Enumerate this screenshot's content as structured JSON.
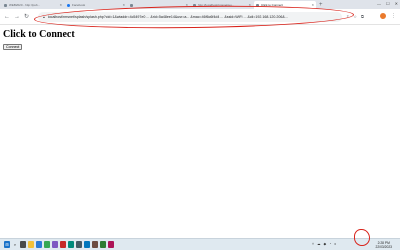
{
  "tabs": [
    {
      "label": "WEB2020 - http://pub...",
      "active": false
    },
    {
      "label": "Facebook",
      "active": false
    },
    {
      "label": "",
      "active": false
    },
    {
      "label": "http://localhost/rmsnet/au...",
      "active": false
    },
    {
      "label": "Click to Connect",
      "active": true
    }
  ],
  "toolbar": {
    "address": "localhost/rmsnet/splash/splash.php?cid=1&wiaddr=4c5497e0 ... &rid=5a48ee14&usr=a... &mac=46f6c6f4d4 ... &ssid=WiFi ... &cli=192.168.120.206&..."
  },
  "page": {
    "heading": "Click to Connect",
    "connect_button": "Connect"
  },
  "taskbar": {
    "time": "2:28 PM",
    "date": "22/03/2023"
  },
  "colors": {
    "annotation": "#d9241c",
    "tab_strip": "#dfe3ea",
    "taskbar": "#dfe9f0"
  },
  "icons": [
    "back-icon",
    "forward-icon",
    "reload-icon",
    "lock-icon",
    "share-icon",
    "star-icon",
    "extensions-icon",
    "profile-avatar",
    "menu-icon",
    "windows-start-icon",
    "search-icon",
    "wifi-icon"
  ]
}
